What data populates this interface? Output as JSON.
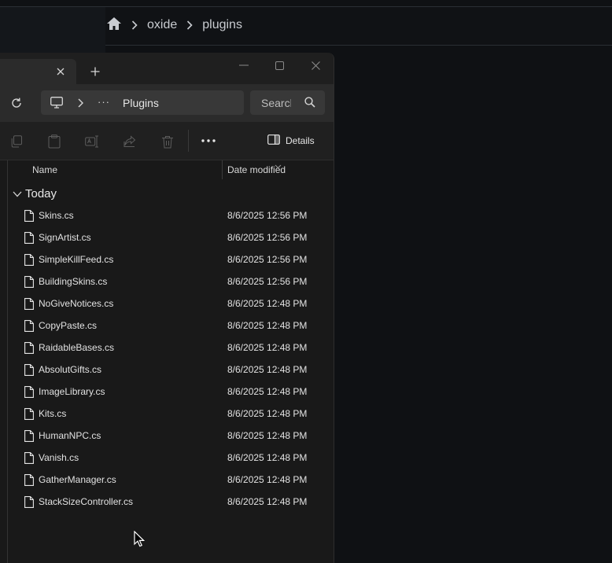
{
  "web": {
    "breadcrumb": {
      "home_icon": "home-icon",
      "items": [
        "oxide",
        "plugins"
      ]
    }
  },
  "explorer": {
    "tab": {
      "close_icon": "close-icon",
      "new_tab_icon": "plus-icon"
    },
    "window_controls": [
      "minimize-icon",
      "maximize-icon",
      "close-icon"
    ],
    "nav": {
      "refresh_icon": "refresh-icon",
      "address": {
        "location_icon": "monitor-icon",
        "overflow": "···",
        "current_folder": "Plugins"
      },
      "search": {
        "placeholder": "Search"
      }
    },
    "toolbar": {
      "icons": [
        "copy-icon",
        "paste-icon",
        "rename-icon",
        "share-icon",
        "delete-icon"
      ],
      "more": "···",
      "details_label": "Details"
    },
    "columns": {
      "name": "Name",
      "date_modified": "Date modified"
    },
    "group": {
      "label": "Today"
    },
    "files": [
      {
        "name": "Skins.cs",
        "date": "8/6/2025 12:56 PM"
      },
      {
        "name": "SignArtist.cs",
        "date": "8/6/2025 12:56 PM"
      },
      {
        "name": "SimpleKillFeed.cs",
        "date": "8/6/2025 12:56 PM"
      },
      {
        "name": "BuildingSkins.cs",
        "date": "8/6/2025 12:56 PM"
      },
      {
        "name": "NoGiveNotices.cs",
        "date": "8/6/2025 12:48 PM"
      },
      {
        "name": "CopyPaste.cs",
        "date": "8/6/2025 12:48 PM"
      },
      {
        "name": "RaidableBases.cs",
        "date": "8/6/2025 12:48 PM"
      },
      {
        "name": "AbsolutGifts.cs",
        "date": "8/6/2025 12:48 PM"
      },
      {
        "name": "ImageLibrary.cs",
        "date": "8/6/2025 12:48 PM"
      },
      {
        "name": "Kits.cs",
        "date": "8/6/2025 12:48 PM"
      },
      {
        "name": "HumanNPC.cs",
        "date": "8/6/2025 12:48 PM"
      },
      {
        "name": "Vanish.cs",
        "date": "8/6/2025 12:48 PM"
      },
      {
        "name": "GatherManager.cs",
        "date": "8/6/2025 12:48 PM"
      },
      {
        "name": "StackSizeController.cs",
        "date": "8/6/2025 12:48 PM"
      }
    ]
  }
}
